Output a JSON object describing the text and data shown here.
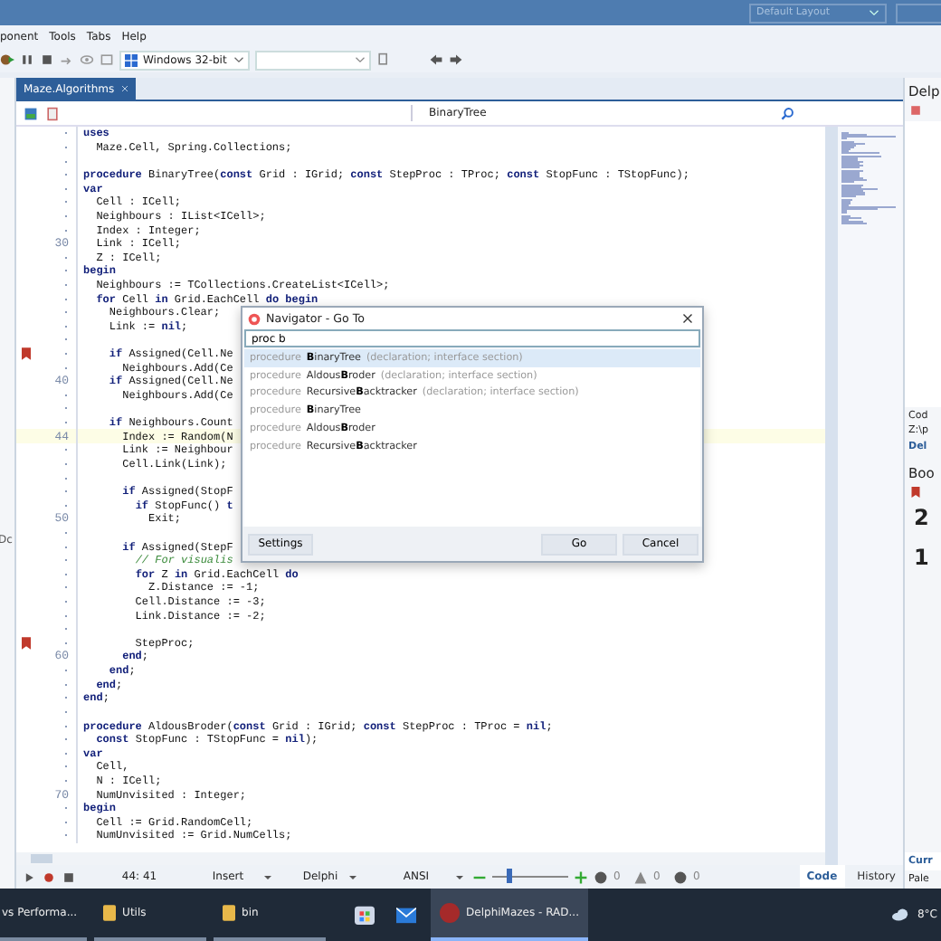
{
  "window": {
    "layout": "Default Layout"
  },
  "menu": [
    "ponent",
    "Tools",
    "Tabs",
    "Help"
  ],
  "toolbar": {
    "platform": "Windows 32-bit"
  },
  "left_panel": {
    "text": "Dc"
  },
  "editor": {
    "tabs": [
      {
        "label": "Maze.Algorithms",
        "selected": true
      }
    ],
    "method": "BinaryTree",
    "lines": [
      {
        "text": "**uses**"
      },
      {
        "text": "  Maze.Cell, Spring.Collections;"
      },
      {
        "blank_before": true,
        "text": "**procedure** BinaryTree(**const** Grid : IGrid; **const** StepProc : TProc; **const** StopFunc : TStopFunc);"
      },
      {
        "text": "**var**"
      },
      {
        "text": "  Cell : ICell;"
      },
      {
        "text": "  Neighbours : IList<ICell>;"
      },
      {
        "text": "  Index : Integer;"
      },
      {
        "number": "30",
        "text": "  Link : ICell;"
      },
      {
        "text": "  Z : ICell;"
      },
      {
        "text": "**begin**"
      },
      {
        "text": "  Neighbours := TCollections.CreateList<ICell>;"
      },
      {
        "text": "  **for** Cell **in** Grid.EachCell **do begin**"
      },
      {
        "text": "    Neighbours.Clear;"
      },
      {
        "text": "    Link := **nil**;"
      },
      {
        "blank_before": true,
        "text": "    **if** Assigned(Cell.Ne",
        "bookmark": true
      },
      {
        "text": "      Neighbours.Add(Ce"
      },
      {
        "number": "40",
        "text": "    **if** Assigned(Cell.Ne"
      },
      {
        "text": "      Neighbours.Add(Ce"
      },
      {
        "blank_before": true,
        "text": "    **if** Neighbours.Count"
      },
      {
        "number": "44",
        "text": "      Index := Random(N",
        "current": true
      },
      {
        "text": "      Link := Neighbour"
      },
      {
        "text": "      Cell.Link(Link);"
      },
      {
        "blank_before": true,
        "text": "      **if** Assigned(StopF"
      },
      {
        "text": "        **if** StopFunc() **t**"
      },
      {
        "number": "50",
        "text": "          Exit;"
      },
      {
        "blank_before": true,
        "text": "      **if** Assigned(StepF"
      },
      {
        "text": "        *// For visualis*"
      },
      {
        "text": "        **for** Z **in** Grid.EachCell **do**"
      },
      {
        "text": "          Z.Distance := -1;"
      },
      {
        "text": "        Cell.Distance := -3;"
      },
      {
        "text": "        Link.Distance := -2;"
      },
      {
        "blank_before": true,
        "text": "        StepProc;",
        "bookmark": true
      },
      {
        "number": "60",
        "text": "      **end**;"
      },
      {
        "text": "    **end**;"
      },
      {
        "text": "  **end**;"
      },
      {
        "text": "**end**;"
      },
      {
        "blank_before": true,
        "text": "**procedure** AldousBroder(**const** Grid : IGrid; **const** StepProc : TProc = **nil**;"
      },
      {
        "text": "  **const** StopFunc : TStopFunc = **nil**);"
      },
      {
        "text": "**var**"
      },
      {
        "text": "  Cell,"
      },
      {
        "text": "  N : ICell;"
      },
      {
        "number": "70",
        "text": "  NumUnvisited : Integer;"
      },
      {
        "text": "**begin**"
      },
      {
        "text": "  Cell := Grid.RandomCell;"
      },
      {
        "text": "  NumUnvisited := Grid.NumCells;"
      }
    ]
  },
  "navigator": {
    "title": "Navigator - Go To",
    "query": "proc b",
    "results": [
      {
        "keyword": "procedure",
        "name": "**B**inaryTree",
        "detail": "(declaration; interface section)",
        "selected": true
      },
      {
        "keyword": "procedure",
        "name": "Aldous**B**roder",
        "detail": "(declaration; interface section)",
        "selected": false
      },
      {
        "keyword": "procedure",
        "name": "Recursive**B**acktracker",
        "detail": "(declaration; interface section)",
        "selected": false
      },
      {
        "keyword": "procedure",
        "name": "**B**inaryTree",
        "selected": false
      },
      {
        "keyword": "procedure",
        "name": "Aldous**B**roder",
        "selected": false
      },
      {
        "keyword": "procedure",
        "name": "Recursive**B**acktracker",
        "selected": false
      }
    ],
    "buttons": [
      "Settings",
      "Go",
      "Cancel"
    ]
  },
  "status_bar": {
    "position": "44: 41",
    "mode": "Insert",
    "language": "Delphi",
    "encoding": "ANSI",
    "zoom": {
      "level": 0.2
    },
    "errors": "0",
    "warnings": "0",
    "hints": "0"
  },
  "view_tabs": [
    {
      "label": "Code",
      "selected": true
    },
    {
      "label": "History",
      "selected": false
    }
  ],
  "right_panel": {
    "title": "Delp",
    "info": [
      "Cod",
      "Z:\\p"
    ],
    "link": "Del",
    "bookmarks_title": "Boo",
    "bookmarks": [
      "2",
      "1"
    ],
    "footer": [
      "Curr",
      "Pale"
    ]
  },
  "taskbar": {
    "items": [
      {
        "label": "vs Performa...",
        "kind": "plain",
        "selected": false
      },
      {
        "label": "Utils",
        "kind": "folder",
        "selected": false
      },
      {
        "label": "bin",
        "kind": "folder",
        "selected": false
      },
      {
        "kind": "store",
        "selected": false
      },
      {
        "kind": "mail",
        "selected": false
      },
      {
        "label": "DelphiMazes - RAD...",
        "kind": "rad",
        "selected": true
      }
    ],
    "temperature": "8°C"
  }
}
